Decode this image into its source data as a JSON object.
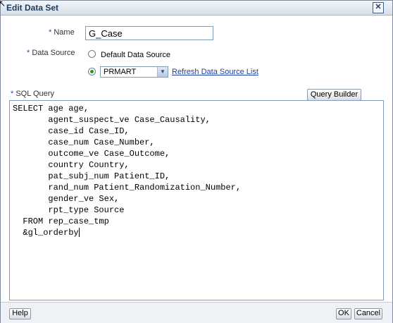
{
  "window": {
    "title": "Edit Data Set"
  },
  "form": {
    "name_label": "Name",
    "name_value": "G_Case",
    "data_source_label": "Data Source",
    "radio_default_label": "Default Data Source",
    "selected_data_source": "PRMART",
    "refresh_link": "Refresh Data Source List",
    "sql_query_label": "SQL Query",
    "query_builder_label": "Query Builder",
    "required_marker": "*"
  },
  "sql": {
    "text": "SELECT age age,\n       agent_suspect_ve Case_Causality,\n       case_id Case_ID,\n       case_num Case_Number,\n       outcome_ve Case_Outcome,\n       country Country,\n       pat_subj_num Patient_ID,\n       rand_num Patient_Randomization_Number,\n       gender_ve Sex,\n       rpt_type Source\n  FROM rep_case_tmp\n  &gl_orderby"
  },
  "footer": {
    "help_label": "Help",
    "ok_label": "OK",
    "cancel_label": "Cancel"
  }
}
